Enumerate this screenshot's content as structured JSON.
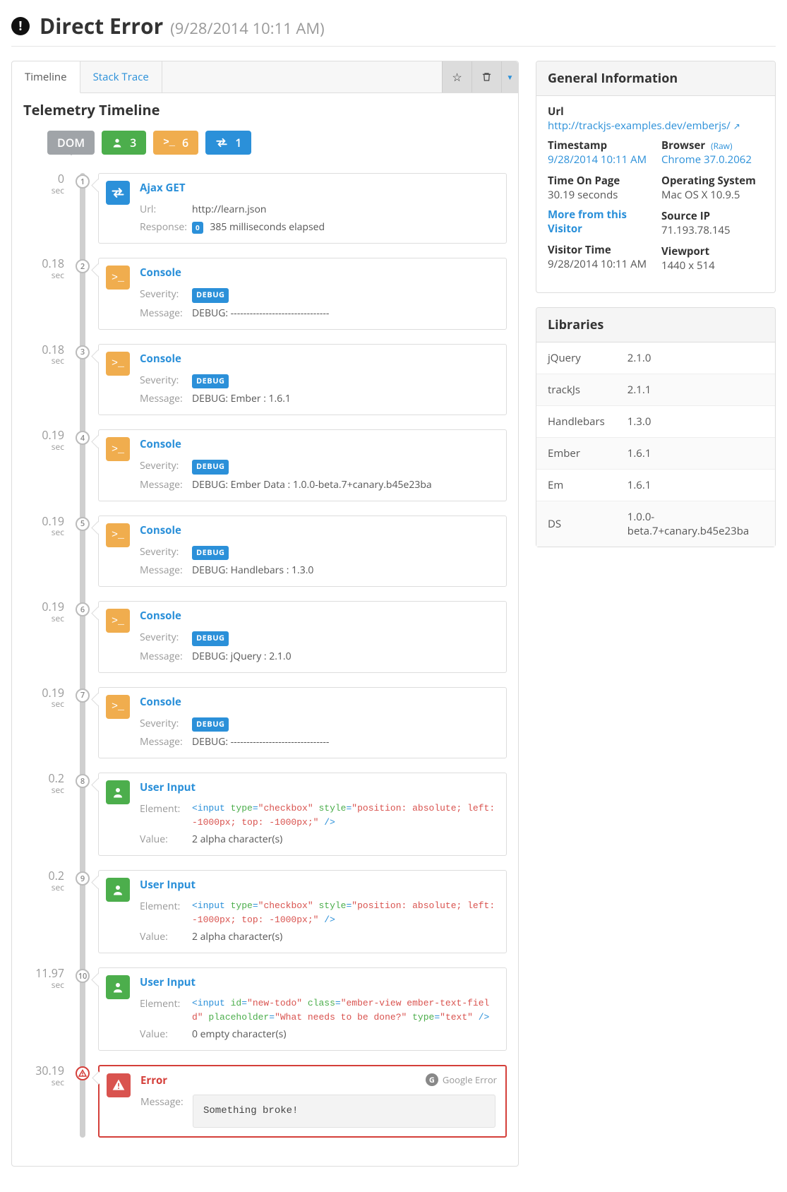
{
  "header": {
    "title": "Direct Error",
    "timestamp": "(9/28/2014 10:11 AM)"
  },
  "tabs": {
    "timeline": "Timeline",
    "stack": "Stack Trace"
  },
  "section": {
    "title": "Telemetry Timeline"
  },
  "filters": {
    "dom": "DOM",
    "user_count": "3",
    "console_count": "6",
    "net_count": "1"
  },
  "events": [
    {
      "time": "0",
      "unit": "sec",
      "idx": "1",
      "type": "net",
      "title": "Ajax GET",
      "rows": [
        {
          "k": "Url:",
          "v": "http://learn.json"
        },
        {
          "k": "Response:",
          "badge_small": "0",
          "v": "385 milliseconds elapsed"
        }
      ]
    },
    {
      "time": "0.18",
      "unit": "sec",
      "idx": "2",
      "type": "console",
      "title": "Console",
      "rows": [
        {
          "k": "Severity:",
          "badge": "DEBUG"
        },
        {
          "k": "Message:",
          "v": "DEBUG: -------------------------------"
        }
      ]
    },
    {
      "time": "0.18",
      "unit": "sec",
      "idx": "3",
      "type": "console",
      "title": "Console",
      "rows": [
        {
          "k": "Severity:",
          "badge": "DEBUG"
        },
        {
          "k": "Message:",
          "v": "DEBUG: Ember      : 1.6.1"
        }
      ]
    },
    {
      "time": "0.19",
      "unit": "sec",
      "idx": "4",
      "type": "console",
      "title": "Console",
      "rows": [
        {
          "k": "Severity:",
          "badge": "DEBUG"
        },
        {
          "k": "Message:",
          "v": "DEBUG: Ember Data : 1.0.0-beta.7+canary.b45e23ba"
        }
      ]
    },
    {
      "time": "0.19",
      "unit": "sec",
      "idx": "5",
      "type": "console",
      "title": "Console",
      "rows": [
        {
          "k": "Severity:",
          "badge": "DEBUG"
        },
        {
          "k": "Message:",
          "v": "DEBUG: Handlebars : 1.3.0"
        }
      ]
    },
    {
      "time": "0.19",
      "unit": "sec",
      "idx": "6",
      "type": "console",
      "title": "Console",
      "rows": [
        {
          "k": "Severity:",
          "badge": "DEBUG"
        },
        {
          "k": "Message:",
          "v": "DEBUG: jQuery     : 2.1.0"
        }
      ]
    },
    {
      "time": "0.19",
      "unit": "sec",
      "idx": "7",
      "type": "console",
      "title": "Console",
      "rows": [
        {
          "k": "Severity:",
          "badge": "DEBUG"
        },
        {
          "k": "Message:",
          "v": "DEBUG: -------------------------------"
        }
      ]
    },
    {
      "time": "0.2",
      "unit": "sec",
      "idx": "8",
      "type": "user",
      "title": "User Input",
      "rows": [
        {
          "k": "Element:",
          "html": [
            [
              "tag",
              "<input "
            ],
            [
              "attr",
              "type"
            ],
            [
              "tag",
              "="
            ],
            [
              "str",
              "\"checkbox\""
            ],
            [
              "tag",
              " "
            ],
            [
              "attr",
              "style"
            ],
            [
              "tag",
              "="
            ],
            [
              "str",
              "\"position: absolute; left: -1000px; top: -1000px;\""
            ],
            [
              "tag",
              " />"
            ]
          ]
        },
        {
          "k": "Value:",
          "v": "2 alpha character(s)"
        }
      ]
    },
    {
      "time": "0.2",
      "unit": "sec",
      "idx": "9",
      "type": "user",
      "title": "User Input",
      "rows": [
        {
          "k": "Element:",
          "html": [
            [
              "tag",
              "<input "
            ],
            [
              "attr",
              "type"
            ],
            [
              "tag",
              "="
            ],
            [
              "str",
              "\"checkbox\""
            ],
            [
              "tag",
              " "
            ],
            [
              "attr",
              "style"
            ],
            [
              "tag",
              "="
            ],
            [
              "str",
              "\"position: absolute; left: -1000px; top: -1000px;\""
            ],
            [
              "tag",
              " />"
            ]
          ]
        },
        {
          "k": "Value:",
          "v": "2 alpha character(s)"
        }
      ]
    },
    {
      "time": "11.97",
      "unit": "sec",
      "idx": "10",
      "type": "user",
      "title": "User Input",
      "rows": [
        {
          "k": "Element:",
          "html": [
            [
              "tag",
              "<input "
            ],
            [
              "attr",
              "id"
            ],
            [
              "tag",
              "="
            ],
            [
              "str",
              "\"new-todo\""
            ],
            [
              "tag",
              " "
            ],
            [
              "attr",
              "class"
            ],
            [
              "tag",
              "="
            ],
            [
              "str",
              "\"ember-view ember-text-field\""
            ],
            [
              "tag",
              " "
            ],
            [
              "attr",
              "placeholder"
            ],
            [
              "tag",
              "="
            ],
            [
              "str",
              "\"What needs to be done?\""
            ],
            [
              "tag",
              " "
            ],
            [
              "attr",
              "type"
            ],
            [
              "tag",
              "="
            ],
            [
              "str",
              "\"text\""
            ],
            [
              "tag",
              " />"
            ]
          ]
        },
        {
          "k": "Value:",
          "v": "0 empty character(s)"
        }
      ]
    },
    {
      "time": "30.19",
      "unit": "sec",
      "idx": "!",
      "type": "error",
      "title": "Error",
      "google": "Google Error",
      "rows": [
        {
          "k": "Message:",
          "err": "Something broke!"
        }
      ]
    }
  ],
  "info": {
    "heading": "General Information",
    "url_label": "Url",
    "url": "http://trackjs-examples.dev/emberjs/",
    "ts_label": "Timestamp",
    "ts": "9/28/2014 10:11 AM",
    "top_label": "Time On Page",
    "top": "30.19 seconds",
    "more": "More from this Visitor",
    "vt_label": "Visitor Time",
    "vt": "9/28/2014 10:11 AM",
    "browser_label": "Browser",
    "raw": "(Raw)",
    "browser": "Chrome 37.0.2062",
    "os_label": "Operating System",
    "os": "Mac OS X 10.9.5",
    "ip_label": "Source IP",
    "ip": "71.193.78.145",
    "vp_label": "Viewport",
    "vp": "1440 x 514"
  },
  "libs": {
    "heading": "Libraries",
    "rows": [
      [
        "jQuery",
        "2.1.0"
      ],
      [
        "trackJs",
        "2.1.1"
      ],
      [
        "Handlebars",
        "1.3.0"
      ],
      [
        "Ember",
        "1.6.1"
      ],
      [
        "Em",
        "1.6.1"
      ],
      [
        "DS",
        "1.0.0-beta.7+canary.b45e23ba"
      ]
    ]
  }
}
